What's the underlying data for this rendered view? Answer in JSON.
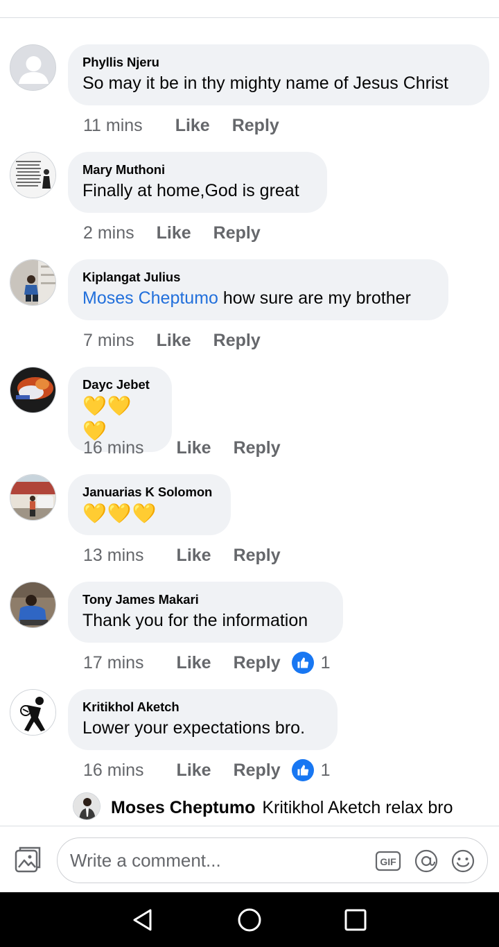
{
  "comments": [
    {
      "author": "Phyllis Njeru",
      "text": "So may it be in thy mighty name of Jesus Christ",
      "time": "11 mins",
      "like": "Like",
      "reply": "Reply"
    },
    {
      "author": "Mary Muthoni",
      "text": "Finally at home,God is great",
      "time": "2 mins",
      "like": "Like",
      "reply": "Reply"
    },
    {
      "author": "Kiplangat Julius",
      "mention": "Moses Cheptumo",
      "text": " how sure are my brother",
      "time": "7 mins",
      "like": "Like",
      "reply": "Reply"
    },
    {
      "author": "Dayc Jebet",
      "text": "💛💛💛",
      "time": "16 mins",
      "like": "Like",
      "reply": "Reply"
    },
    {
      "author": "Januarias K Solomon",
      "text": "💛💛💛",
      "time": "13 mins",
      "like": "Like",
      "reply": "Reply"
    },
    {
      "author": "Tony James Makari",
      "text": "Thank you for the information",
      "time": "17 mins",
      "like": "Like",
      "reply": "Reply",
      "reaction_count": "1"
    },
    {
      "author": "Kritikhol Aketch",
      "text": "Lower your expectations bro.",
      "time": "16 mins",
      "like": "Like",
      "reply": "Reply",
      "reaction_count": "1"
    }
  ],
  "reply_preview": {
    "author": "Moses Cheptumo",
    "text": "Kritikhol Aketch relax bro"
  },
  "composer": {
    "placeholder": "Write a comment...",
    "gif_label": "GIF"
  },
  "icons": {
    "reaction": "like-thumb-icon",
    "photo": "photo-icon",
    "gif": "gif-icon",
    "mention": "at-icon",
    "emoji": "emoji-icon",
    "nav": [
      "back-icon",
      "home-icon",
      "recents-icon"
    ]
  },
  "colors": {
    "accent": "#1877f2",
    "mention": "#216fdb",
    "bubble": "#f0f2f5",
    "meta": "#65676b"
  }
}
